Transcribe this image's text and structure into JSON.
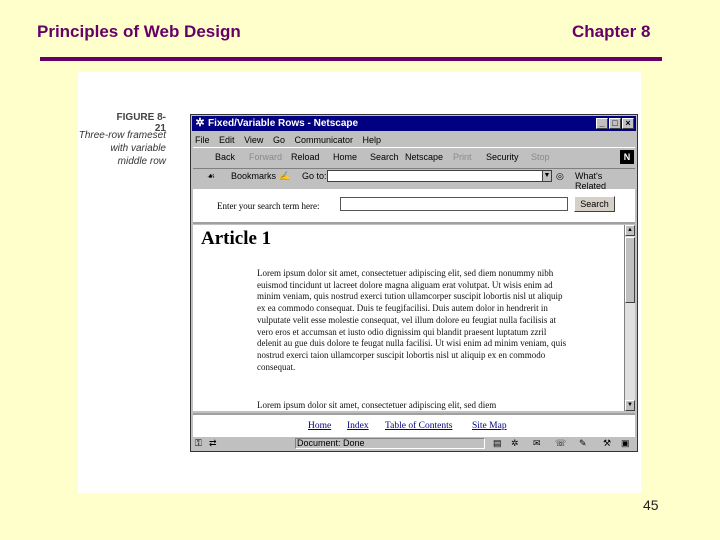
{
  "slide": {
    "title": "Principles of Web Design",
    "chapter": "Chapter 8",
    "page_number": "45"
  },
  "figure": {
    "label": "FIGURE 8-21",
    "caption_lines": [
      "Three-row frameset",
      "with variable",
      "middle row"
    ]
  },
  "browser": {
    "window_title": "Fixed/Variable Rows - Netscape",
    "menu": [
      "File",
      "Edit",
      "View",
      "Go",
      "Communicator",
      "Help"
    ],
    "nav_buttons": [
      "Back",
      "Forward",
      "Reload",
      "Home",
      "Search",
      "Netscape",
      "Print",
      "Security",
      "Stop"
    ],
    "location": {
      "bookmarks_label": "Bookmarks",
      "goto_label": "Go to:",
      "whats_related": "What's Related"
    },
    "status_text": "Document: Done"
  },
  "frame_top": {
    "search_label": "Enter your search term here:",
    "search_button": "Search"
  },
  "frame_middle": {
    "article_title": "Article 1",
    "paragraph_1": "Lorem ipsum dolor sit amet, consectetuer adipiscing elit, sed diem nonummy nibh euismod tincidunt ut lacreet dolore magna aliguam erat volutpat. Ut wisis enim ad minim veniam, quis nostrud exerci tution ullamcorper suscipit lobortis nisl ut aliquip ex ea commodo consequat. Duis te feugifacilisi. Duis autem dolor in hendrerit in vulputate velit esse molestie consequat, vel illum dolore eu feugiat nulla facilisis at vero eros et accumsan et iusto odio dignissim qui blandit praesent luptatum zzril delenit au gue duis dolore te feugat nulla facilisi. Ut wisi enim ad minim veniam, quis nostrud exerci taion ullamcorper suscipit lobortis nisl ut aliquip ex en commodo consequat.",
    "paragraph_2": "Lorem ipsum dolor sit amet, consectetuer adipiscing elit, sed diem"
  },
  "frame_bottom": {
    "links": [
      "Home",
      "Index",
      "Table of Contents",
      "Site Map"
    ]
  }
}
